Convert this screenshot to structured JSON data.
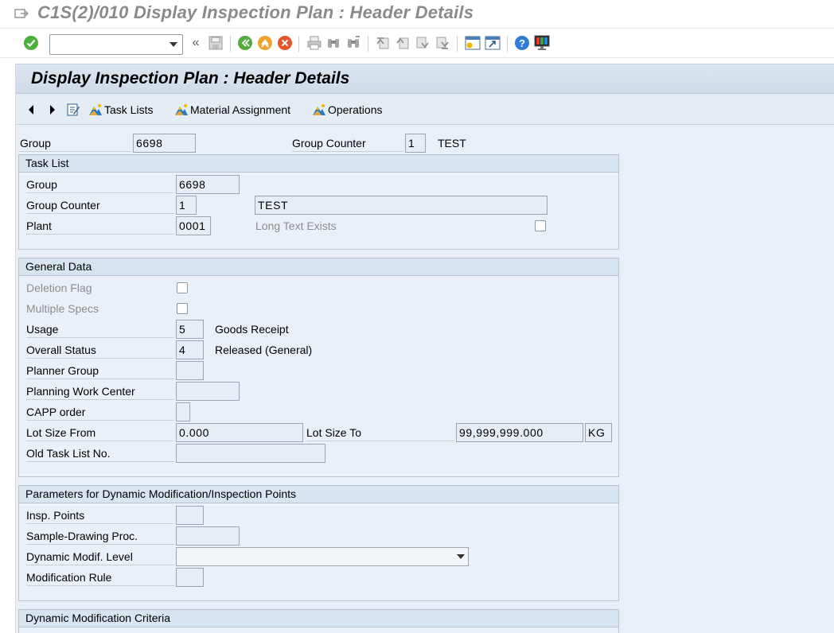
{
  "window": {
    "title": "C1S(2)/010 Display Inspection Plan : Header Details"
  },
  "system_toolbar": {
    "command_field_value": "",
    "icons": [
      "enter-icon",
      "collapse-icon",
      "save-icon",
      "back-icon",
      "exit-icon",
      "cancel-icon",
      "print-icon",
      "find-icon",
      "find-next-icon",
      "first-page-icon",
      "previous-page-icon",
      "next-page-icon",
      "last-page-icon",
      "create-session-icon",
      "shortcut-icon",
      "help-icon",
      "customize-layout-icon"
    ]
  },
  "screen": {
    "title": "Display Inspection Plan : Header Details",
    "toolbar": {
      "task_lists": "Task Lists",
      "material_assignment": "Material Assignment",
      "operations": "Operations"
    }
  },
  "header": {
    "group_label": "Group",
    "group_value": "6698",
    "group_counter_label": "Group Counter",
    "group_counter_value": "1",
    "group_counter_text": "TEST"
  },
  "task_list": {
    "title": "Task List",
    "group_label": "Group",
    "group_value": "6698",
    "group_counter_label": "Group Counter",
    "group_counter_value": "1",
    "description": "TEST",
    "plant_label": "Plant",
    "plant_value": "0001",
    "long_text_label": "Long Text Exists"
  },
  "general_data": {
    "title": "General Data",
    "deletion_flag_label": "Deletion Flag",
    "multiple_specs_label": "Multiple Specs",
    "usage_label": "Usage",
    "usage_value": "5",
    "usage_text": "Goods Receipt",
    "overall_status_label": "Overall Status",
    "overall_status_value": "4",
    "overall_status_text": "Released (General)",
    "planner_group_label": "Planner Group",
    "planner_group_value": "",
    "planning_work_center_label": "Planning Work Center",
    "planning_work_center_value": "",
    "capp_order_label": "CAPP order",
    "capp_order_value": "",
    "lot_size_from_label": "Lot Size From",
    "lot_size_from_value": "0.000",
    "lot_size_to_label": "Lot Size To",
    "lot_size_to_value": "99,999,999.000",
    "lot_size_unit": "KG",
    "old_task_list_label": "Old Task List No.",
    "old_task_list_value": ""
  },
  "dynamic_params": {
    "title": "Parameters for Dynamic Modification/Inspection Points",
    "insp_points_label": "Insp. Points",
    "insp_points_value": "",
    "sample_drawing_label": "Sample-Drawing Proc.",
    "sample_drawing_value": "",
    "dyn_modif_level_label": "Dynamic Modif. Level",
    "dyn_modif_level_value": "",
    "modification_rule_label": "Modification Rule",
    "modification_rule_value": ""
  },
  "dynamic_criteria": {
    "title": "Dynamic Modification Criteria"
  }
}
